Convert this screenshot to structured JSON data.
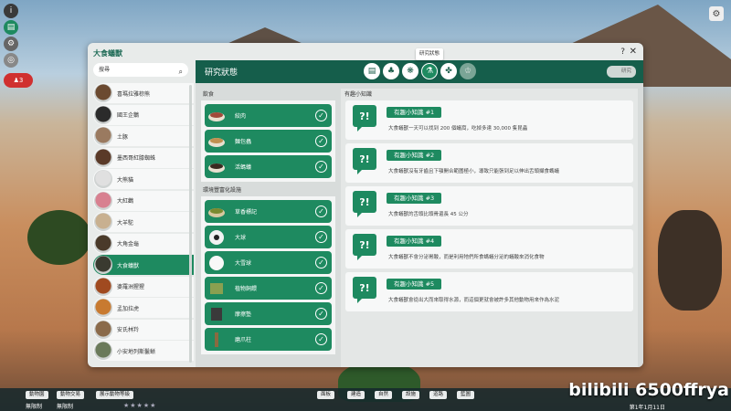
{
  "window": {
    "title": "大食蟻獸",
    "help": "?",
    "close": "✕"
  },
  "tooltip": "研究狀態",
  "search": {
    "value": "搜尋"
  },
  "species": [
    {
      "name": "喜瑪拉雅棕熊",
      "color": "#6b4a30"
    },
    {
      "name": "國王企鵝",
      "color": "#2b2b2b"
    },
    {
      "name": "土豚",
      "color": "#9a7a60"
    },
    {
      "name": "墨西哥紅膝蜘蛛",
      "color": "#5a3a28"
    },
    {
      "name": "大熊貓",
      "color": "#e0e0e0"
    },
    {
      "name": "大紅鸛",
      "color": "#d88090"
    },
    {
      "name": "大羊駝",
      "color": "#c8b090"
    },
    {
      "name": "大角金龜",
      "color": "#4a3a2a"
    },
    {
      "name": "大食蟻獸",
      "color": "#3a3a30",
      "active": true
    },
    {
      "name": "婆羅洲猩猩",
      "color": "#a04a20"
    },
    {
      "name": "孟加拉虎",
      "color": "#c87a30"
    },
    {
      "name": "安氏林羚",
      "color": "#8a6a4a"
    },
    {
      "name": "小安地列斯鬣蜥",
      "color": "#6a7a5a"
    },
    {
      "name": "小熊貓",
      "color": "#b05a2a"
    },
    {
      "name": "巴西三帶犰狳",
      "color": "#7a6a5a"
    }
  ],
  "panel": {
    "title": "研究狀態",
    "tabs": [
      {
        "icon": "document-icon",
        "glyph": "▤"
      },
      {
        "icon": "tree-icon",
        "glyph": "♣"
      },
      {
        "icon": "paw-print-icon",
        "glyph": "❋"
      },
      {
        "icon": "flask-icon",
        "glyph": "⚗",
        "active": true
      },
      {
        "icon": "paw-icon",
        "glyph": "✤"
      },
      {
        "icon": "trophy-icon",
        "glyph": "♔",
        "dim": true
      }
    ],
    "header_button": "研究"
  },
  "research": {
    "diet_label": "飲食",
    "diet": [
      {
        "name": "絞肉",
        "icon": "meat-bowl-icon"
      },
      {
        "name": "麵包蟲",
        "icon": "worm-bowl-icon"
      },
      {
        "name": "活螞蟻",
        "icon": "ant-bowl-icon"
      }
    ],
    "enrichment_label": "環境豐富化設施",
    "enrichment": [
      {
        "name": "草香標記",
        "icon": "herb-bowl-icon"
      },
      {
        "name": "大球",
        "icon": "soccer-ball-icon"
      },
      {
        "name": "大雪球",
        "icon": "snowball-icon"
      },
      {
        "name": "植物飼餵",
        "icon": "plant-feeder-icon"
      },
      {
        "name": "摩擦墊",
        "icon": "scratch-pad-icon"
      },
      {
        "name": "磨爪柱",
        "icon": "scratch-post-icon"
      }
    ]
  },
  "facts": {
    "label": "有趣小知識",
    "items": [
      {
        "title": "有趣小知識 #1",
        "text": "大食蟻獸一天可以找到 200 個蟻窩，吃掉多達 30,000 隻昆蟲"
      },
      {
        "title": "有趣小知識 #2",
        "text": "大食蟻獸沒有牙齒且下顎開合範圍極小，導致只能張到足以伸出舌頭擷食螞蟻"
      },
      {
        "title": "有趣小知識 #3",
        "text": "大食蟻獸的舌頭比頭骨還長 45 公分"
      },
      {
        "title": "有趣小知識 #4",
        "text": "大食蟻獸不會分泌胃酸，而是利用牠們所食螞蟻分泌的蟻酸來消化食物"
      },
      {
        "title": "有趣小知識 #5",
        "text": "大食蟻獸會從出大而來取得水源，而這個更就會被許多其他動物用來作為水泥"
      }
    ]
  },
  "bottom": {
    "buttons": [
      "動物園",
      "動物交易",
      "展示動物等級"
    ],
    "tools": [
      "面板",
      "建造",
      "自然",
      "設施",
      "道路",
      "藍圖"
    ],
    "unlimited1": "無限制",
    "unlimited2": "無限制",
    "date": "第1年1月11日",
    "watermark": "bilibili 6500ffrya"
  },
  "top_right": "⚙",
  "hud_badge": "3"
}
